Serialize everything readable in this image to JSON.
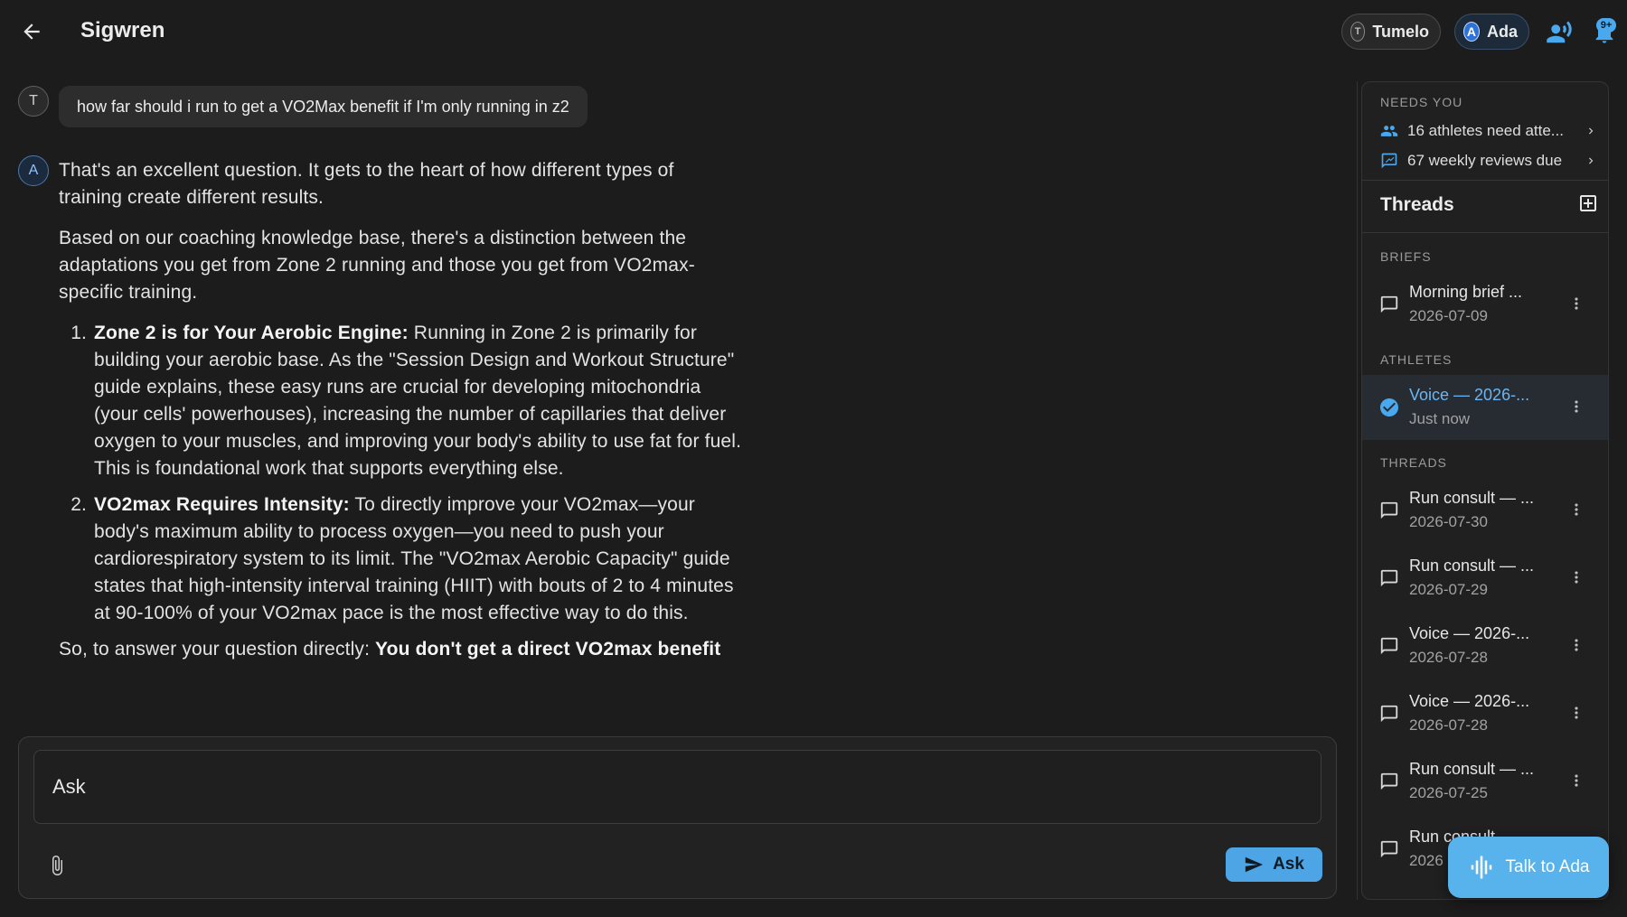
{
  "header": {
    "title": "Sigwren",
    "chips": [
      {
        "avatar": "T",
        "label": "Tumelo"
      },
      {
        "avatar": "A",
        "label": "Ada"
      }
    ],
    "notifications_badge": "9+",
    "icons": {
      "back": "arrow-left-icon",
      "voice": "record-voice-icon",
      "bell": "bell-icon"
    }
  },
  "chat": {
    "user_avatar": "T",
    "ai_avatar": "A",
    "user_message": "how far should i run to get a VO2Max benefit if I'm only running in z2",
    "answer": {
      "intro": "That's an excellent question. It gets to the heart of how different types of training create different results.",
      "para2": "Based on our coaching knowledge base, there's a distinction between the adaptations you get from Zone 2 running and those you get from VO2max-specific training.",
      "items": [
        {
          "bold": "Zone 2 is for Your Aerobic Engine:",
          "text": " Running in Zone 2 is primarily for building your aerobic base. As the \"Session Design and Workout Structure\" guide explains, these easy runs are crucial for developing mitochondria (your cells' powerhouses), increasing the number of capillaries that deliver oxygen to your muscles, and improving your body's ability to use fat for fuel. This is foundational work that supports everything else."
        },
        {
          "bold": "VO2max Requires Intensity:",
          "text": " To directly improve your VO2max—your body's maximum ability to process oxygen—you need to push your cardiorespiratory system to its limit. The \"VO2max Aerobic Capacity\" guide states that high-intensity interval training (HIIT) with bouts of 2 to 4 minutes at 90-100% of your VO2max pace is the most effective way to do this."
        }
      ],
      "closing_prefix": "So, to answer your question directly: ",
      "closing_bold": "You don't get a direct VO2max benefit"
    }
  },
  "composer": {
    "placeholder": "Ask",
    "send_label": "Ask",
    "icons": {
      "attach": "paperclip-icon",
      "send": "send-icon"
    }
  },
  "sidebar": {
    "needs_you_label": "NEEDS YOU",
    "needs_you": [
      {
        "icon": "group-icon",
        "label": "16 athletes need atte..."
      },
      {
        "icon": "review-icon",
        "label": "67 weekly reviews due"
      }
    ],
    "threads_title": "Threads",
    "briefs_label": "BRIEFS",
    "athletes_label": "ATHLETES",
    "threads_label": "THREADS",
    "briefs": [
      {
        "title": "Morning brief ...",
        "sub": "2026-07-09"
      }
    ],
    "athletes": [
      {
        "title": "Voice — 2026-...",
        "sub": "Just now"
      }
    ],
    "threads": [
      {
        "title": "Run consult — ...",
        "sub": "2026-07-30"
      },
      {
        "title": "Run consult — ...",
        "sub": "2026-07-29"
      },
      {
        "title": "Voice — 2026-...",
        "sub": "2026-07-28"
      },
      {
        "title": "Voice — 2026-...",
        "sub": "2026-07-28"
      },
      {
        "title": "Run consult — ...",
        "sub": "2026-07-25"
      },
      {
        "title": "Run consult",
        "sub": "2026"
      }
    ]
  },
  "talk_button": {
    "label": "Talk to Ada",
    "icon": "waveform-icon"
  },
  "colors": {
    "accent": "#4ea5e6",
    "background": "#1c1c1c",
    "panel": "#202020",
    "active_thread": "#6bb6f2"
  }
}
